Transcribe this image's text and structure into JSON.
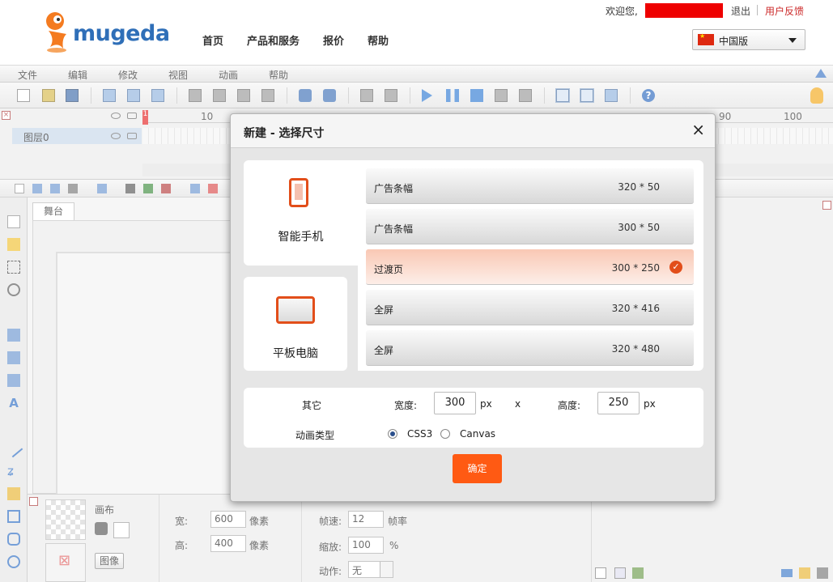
{
  "header": {
    "logo_text": "mugeda",
    "nav": [
      "首页",
      "产品和服务",
      "报价",
      "帮助"
    ],
    "welcome": "欢迎您,",
    "logout": "退出",
    "feedback": "用户反馈",
    "language": "中国版"
  },
  "editor": {
    "menu": [
      "文件",
      "编辑",
      "修改",
      "视图",
      "动画",
      "帮助"
    ],
    "timeline": {
      "ruler_numbers": [
        "10",
        "90",
        "100"
      ],
      "playhead": "1",
      "layer_name": "图层0"
    },
    "stage_tab": "舞台",
    "props": {
      "canvas_label": "画布",
      "image_button": "图像",
      "width_label": "宽:",
      "width_value": "600",
      "width_unit": "像素",
      "height_label": "高:",
      "height_value": "400",
      "height_unit": "像素",
      "fps_label": "帧速:",
      "fps_value": "12",
      "fps_unit": "帧率",
      "zoom_label": "缩放:",
      "zoom_value": "100",
      "zoom_unit": "%",
      "action_label": "动作:",
      "action_value": "无"
    }
  },
  "dialog": {
    "title": "新建 - 选择尺寸",
    "close": "×",
    "devices": [
      {
        "label": "智能手机",
        "icon": "smartphone-icon"
      },
      {
        "label": "平板电脑",
        "icon": "tablet-icon"
      }
    ],
    "sizes": [
      {
        "name": "广告条幅",
        "dim": "320 * 50",
        "selected": false
      },
      {
        "name": "广告条幅",
        "dim": "300 * 50",
        "selected": false
      },
      {
        "name": "过渡页",
        "dim": "300 * 250",
        "selected": true
      },
      {
        "name": "全屏",
        "dim": "320 * 416",
        "selected": false
      },
      {
        "name": "全屏",
        "dim": "320 * 480",
        "selected": false
      }
    ],
    "other": {
      "label": "其它",
      "width_label": "宽度:",
      "width_value": "300",
      "unit": "px",
      "x": "x",
      "height_label": "高度:",
      "height_value": "250",
      "anim_label": "动画类型",
      "options": [
        "CSS3",
        "Canvas"
      ],
      "selected_option": "CSS3"
    },
    "confirm": "确定"
  },
  "colors": {
    "accent": "#ff5a13",
    "selected_bg": "#f9c8b4",
    "brand_blue": "#2f6fb8",
    "user_name_block": "#ee0000"
  }
}
